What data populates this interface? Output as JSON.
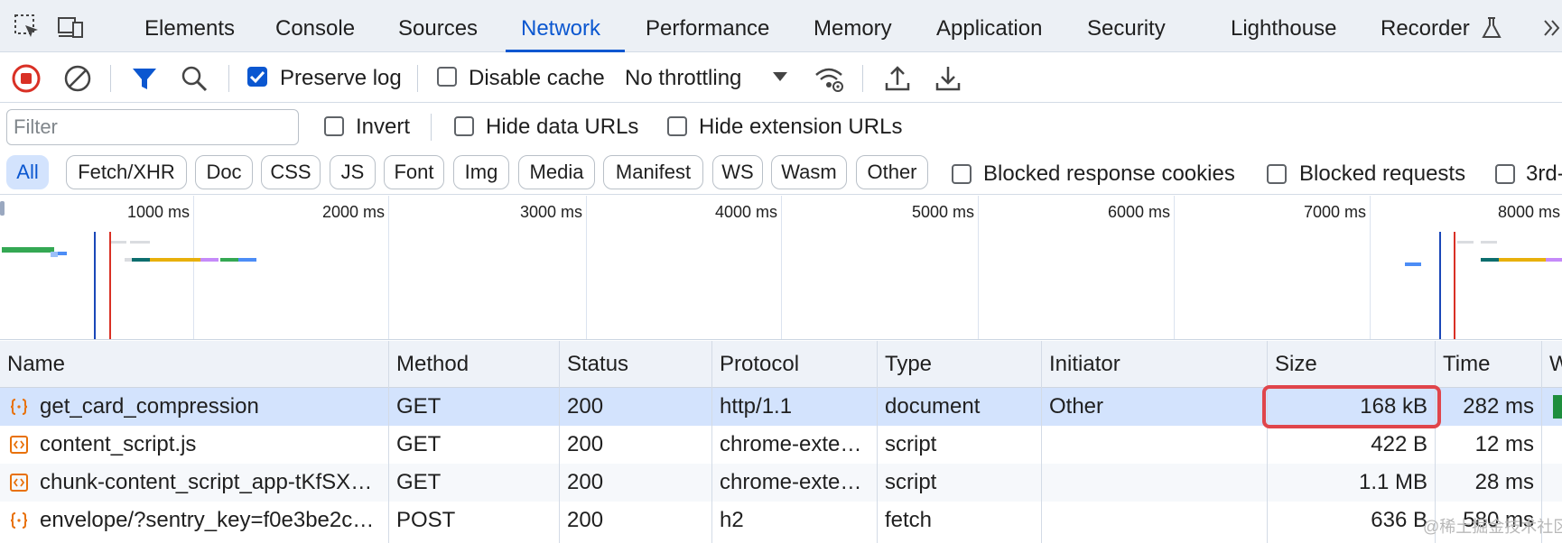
{
  "tabs": {
    "items": [
      {
        "label": "Elements"
      },
      {
        "label": "Console"
      },
      {
        "label": "Sources"
      },
      {
        "label": "Network"
      },
      {
        "label": "Performance"
      },
      {
        "label": "Memory"
      },
      {
        "label": "Application"
      },
      {
        "label": "Security"
      },
      {
        "label": "Lighthouse"
      },
      {
        "label": "Recorder"
      }
    ],
    "active": "Network",
    "more_icon": "double-chevron-right-icon"
  },
  "toolbar": {
    "preserve_log": {
      "label": "Preserve log",
      "checked": true
    },
    "disable_cache": {
      "label": "Disable cache",
      "checked": false
    },
    "throttling": {
      "value": "No throttling"
    }
  },
  "filter": {
    "placeholder": "Filter",
    "value": "",
    "invert": {
      "label": "Invert",
      "checked": false
    },
    "hide_data_urls": {
      "label": "Hide data URLs",
      "checked": false
    },
    "hide_extension_urls": {
      "label": "Hide extension URLs",
      "checked": false
    }
  },
  "type_filters": {
    "chips": [
      "All",
      "Fetch/XHR",
      "Doc",
      "CSS",
      "JS",
      "Font",
      "Img",
      "Media",
      "Manifest",
      "WS",
      "Wasm",
      "Other"
    ],
    "active": "All",
    "blocked_response_cookies": {
      "label": "Blocked response cookies",
      "checked": false
    },
    "blocked_requests": {
      "label": "Blocked requests",
      "checked": false
    },
    "third_party": {
      "label": "3rd-",
      "checked": false
    }
  },
  "overview": {
    "ticks": [
      "1000 ms",
      "2000 ms",
      "3000 ms",
      "4000 ms",
      "5000 ms",
      "6000 ms",
      "7000 ms",
      "8000 ms"
    ],
    "colors": {
      "dom_content_loaded": "#1a47b8",
      "load": "#d93025",
      "green": "#34a853",
      "teal": "#0d6e6e",
      "yellow": "#e8b00b",
      "purple": "#c58af9",
      "blue": "#4c8df6"
    }
  },
  "table": {
    "columns": [
      "Name",
      "Method",
      "Status",
      "Protocol",
      "Type",
      "Initiator",
      "Size",
      "Time",
      "W"
    ],
    "rows": [
      {
        "name": "get_card_compression",
        "method": "GET",
        "status": "200",
        "protocol": "http/1.1",
        "type": "document",
        "initiator": "Other",
        "size": "168 kB",
        "time": "282 ms",
        "icon": "json-icon",
        "selected": true
      },
      {
        "name": "content_script.js",
        "method": "GET",
        "status": "200",
        "protocol": "chrome-exte…",
        "type": "script",
        "initiator": "",
        "size": "422 B",
        "time": "12 ms",
        "icon": "script-icon",
        "selected": false
      },
      {
        "name": "chunk-content_script_app-tKfSX…",
        "method": "GET",
        "status": "200",
        "protocol": "chrome-exte…",
        "type": "script",
        "initiator": "",
        "size": "1.1 MB",
        "time": "28 ms",
        "icon": "script-icon",
        "selected": false
      },
      {
        "name": "envelope/?sentry_key=f0e3be2c…",
        "method": "POST",
        "status": "200",
        "protocol": "h2",
        "type": "fetch",
        "initiator": "",
        "size": "636 B",
        "time": "580 ms",
        "icon": "json-icon",
        "selected": false
      }
    ]
  },
  "watermark": "@稀土掘金技术社区",
  "colors": {
    "accent": "#0b57d0",
    "highlight": "#e0454b",
    "record_stop": "#d93025"
  }
}
